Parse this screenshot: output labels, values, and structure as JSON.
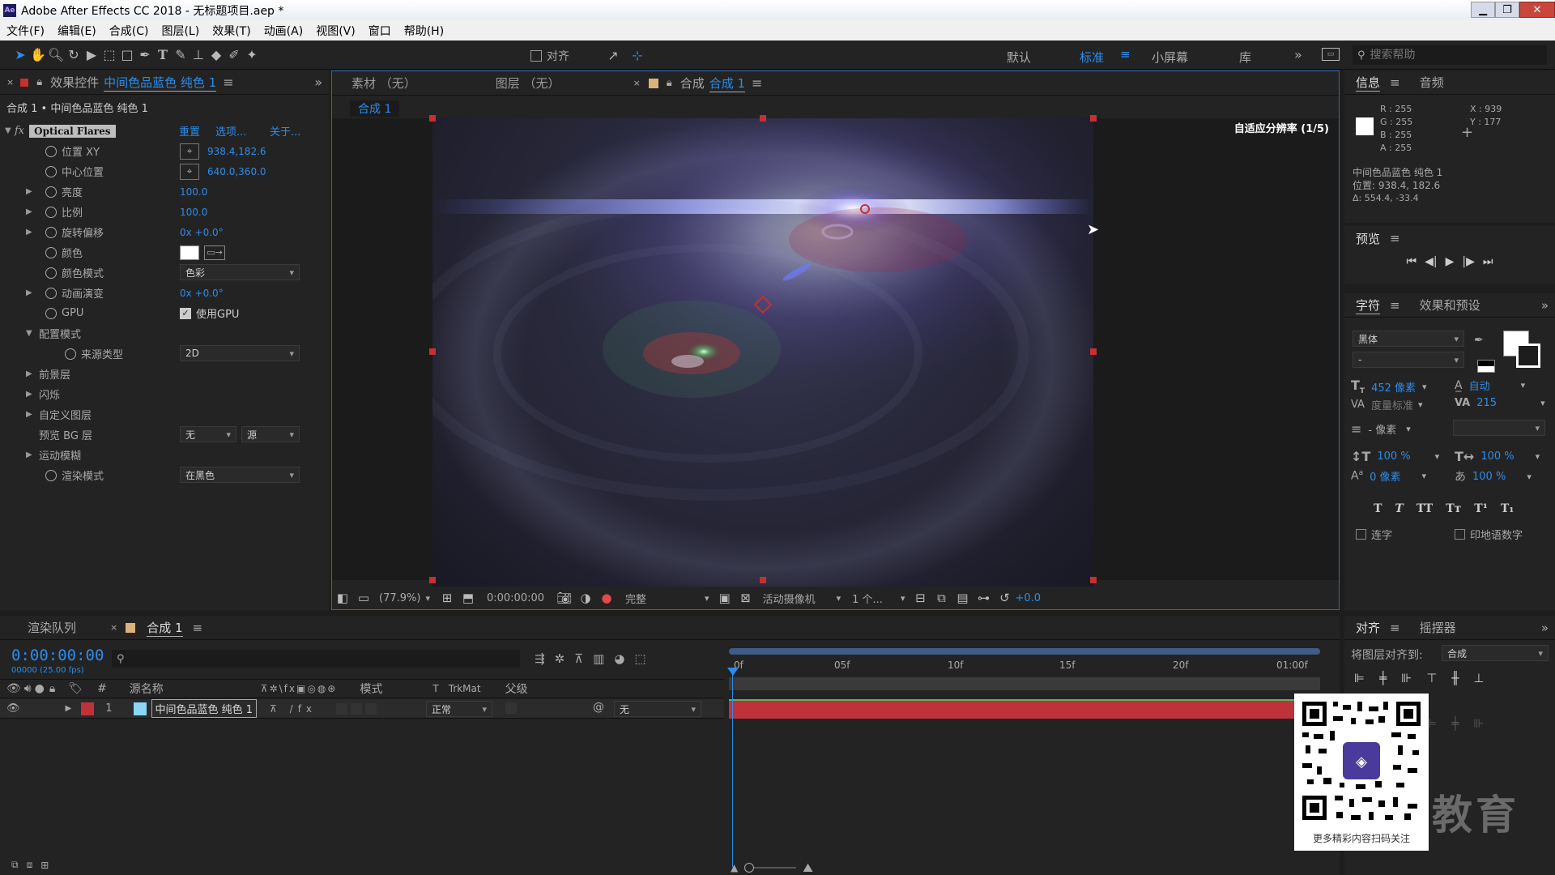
{
  "window": {
    "app_badge": "Ae",
    "title": "Adobe After Effects CC 2018 - 无标题项目.aep *"
  },
  "menu": [
    "文件(F)",
    "编辑(E)",
    "合成(C)",
    "图层(L)",
    "效果(T)",
    "动画(A)",
    "视图(V)",
    "窗口",
    "帮助(H)"
  ],
  "toolbar": {
    "align_label": "对齐",
    "workspaces": [
      "默认",
      "标准",
      "小屏幕",
      "库"
    ],
    "active_workspace": "标准",
    "search_placeholder": "搜索帮助"
  },
  "effects_panel": {
    "tab_label": "效果控件",
    "tab_layer": "中间色品蓝色 纯色 1",
    "breadcrumb": "合成 1 • 中间色品蓝色 纯色 1",
    "effect_name": "Optical Flares",
    "reset_label": "重置",
    "options_label": "选项...",
    "about_label": "关于...",
    "props": {
      "position_xy_label": "位置 XY",
      "position_xy_value": "938.4,182.6",
      "center_label": "中心位置",
      "center_value": "640.0,360.0",
      "brightness_label": "亮度",
      "brightness_value": "100.0",
      "scale_label": "比例",
      "scale_value": "100.0",
      "rotation_label": "旋转偏移",
      "rotation_value": "0x +0.0°",
      "color_label": "颜色",
      "color_mode_label": "颜色模式",
      "color_mode_value": "色彩",
      "anim_label": "动画演变",
      "anim_value": "0x +0.0°",
      "gpu_label": "GPU",
      "gpu_check_label": "使用GPU",
      "config_label": "配置模式",
      "source_type_label": "来源类型",
      "source_type_value": "2D",
      "foreground_label": "前景层",
      "flicker_label": "闪烁",
      "custom_layer_label": "自定义图层",
      "preview_bg_label": "预览 BG 层",
      "preview_bg_value1": "无",
      "preview_bg_value2": "源",
      "motion_blur_label": "运动模糊",
      "render_mode_label": "渲染模式",
      "render_mode_value": "在黑色"
    }
  },
  "viewer": {
    "tab_footage": "素材 （无）",
    "tab_layer": "图层 （无）",
    "tab_comp_prefix": "合成",
    "tab_comp_name": "合成 1",
    "subtab": "合成 1",
    "adaptive_res": "自适应分辨率 (1/5)",
    "zoom": "(77.9%)",
    "timecode": "0:00:00:00",
    "quality": "完整",
    "camera": "活动摄像机",
    "views": "1 个...",
    "exposure": "+0.0"
  },
  "info_panel": {
    "tab_info": "信息",
    "tab_audio": "音频",
    "r": "R : 255",
    "g": "G : 255",
    "b": "B : 255",
    "a": "A : 255",
    "x": "X : 939",
    "y": "Y : 177",
    "layer_name": "中间色品蓝色 纯色 1",
    "position": "位置: 938.4, 182.6",
    "delta": "Δ: 554.4, -33.4"
  },
  "preview_panel": {
    "title": "预览"
  },
  "character_panel": {
    "tab_char": "字符",
    "tab_effects": "效果和预设",
    "font": "黑体",
    "style": "-",
    "size": "452 像素",
    "leading": "自动",
    "kerning": "度量标准",
    "tracking": "215",
    "stroke": "- 像素",
    "vscale": "100 %",
    "hscale": "100 %",
    "baseline": "0 像素",
    "tsume": "100 %",
    "style_buttons": [
      "T",
      "T",
      "TT",
      "Tт",
      "T¹",
      "T₁"
    ],
    "ligature": "连字",
    "hindi_digits": "印地语数字"
  },
  "align_panel": {
    "tab_align": "对齐",
    "tab_wiggler": "摇摆器",
    "align_to_label": "将图层对齐到:",
    "align_to_value": "合成"
  },
  "timeline": {
    "tab_render": "渲染队列",
    "tab_comp": "合成 1",
    "timecode": "0:00:00:00",
    "fps": "00000 (25.00 fps)",
    "col_source": "源名称",
    "col_mode": "模式",
    "col_t": "T",
    "col_trkmat": "TrkMat",
    "col_parent": "父级",
    "layer_index": "1",
    "layer_name": "中间色品蓝色 纯色 1",
    "layer_mode": "正常",
    "layer_parent": "无",
    "ruler": [
      "0f",
      "05f",
      "10f",
      "15f",
      "20f",
      "01:00f"
    ]
  },
  "watermark": {
    "qr_caption": "更多精彩内容扫码关注",
    "brand_text": "教育"
  },
  "colors": {
    "accent": "#2d8ceb",
    "layer_label": "#c0323a",
    "layer_swatch": "#89d7f5"
  }
}
